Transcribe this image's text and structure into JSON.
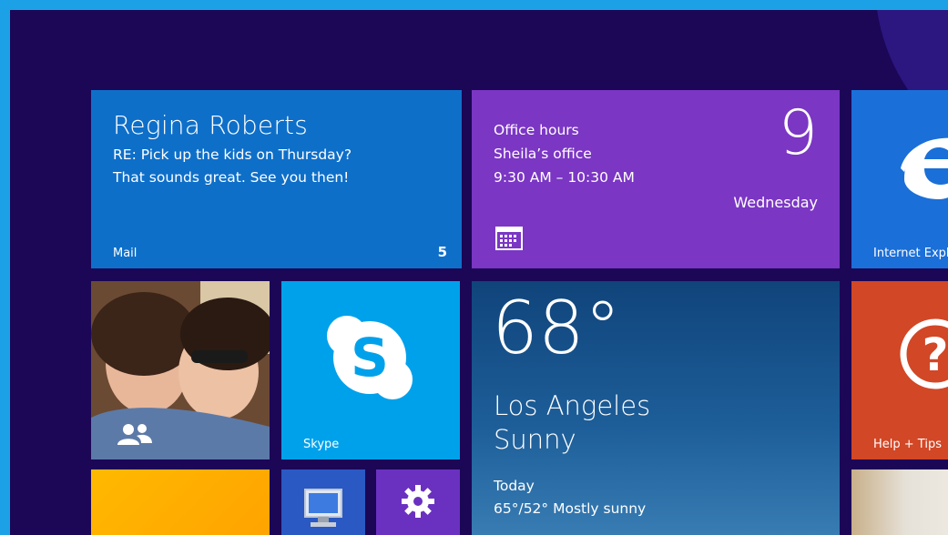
{
  "mail": {
    "sender": "Regina Roberts",
    "line1": "RE: Pick up the kids on Thursday?",
    "line2": "That sounds great. See you then!",
    "label": "Mail",
    "count": "5"
  },
  "calendar": {
    "event_title": "Office hours",
    "event_location": "Sheila’s office",
    "event_time": "9:30 AM – 10:30 AM",
    "day": "9",
    "weekday": "Wednesday",
    "icon": "calendar-icon"
  },
  "ie": {
    "label": "Internet Explorer",
    "icon": "internet-explorer-icon"
  },
  "people": {
    "icon": "people-icon"
  },
  "skype": {
    "label": "Skype",
    "icon": "skype-icon"
  },
  "weather": {
    "temperature": "68°",
    "city": "Los Angeles",
    "condition": "Sunny",
    "today_label": "Today",
    "forecast": "65°/52° Mostly sunny"
  },
  "help": {
    "label": "Help + Tips",
    "icon": "question-mark-icon"
  },
  "desktop": {
    "icon": "desktop-computer-icon"
  },
  "settings": {
    "icon": "gear-icon"
  },
  "colors": {
    "background": "#1b0756",
    "accent_edge": "#1da1e6",
    "mail": "#0e6fc9",
    "calendar": "#7b36c4",
    "skype": "#00a1eb",
    "help": "#d24726"
  }
}
